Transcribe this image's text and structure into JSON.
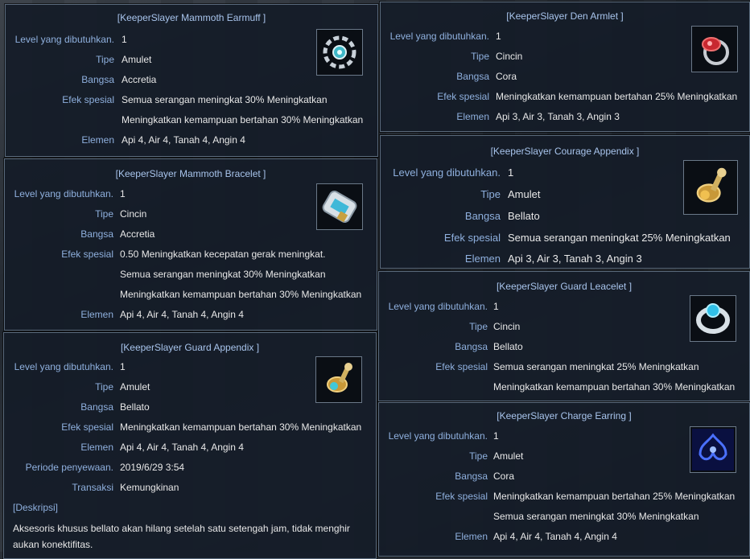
{
  "tooltips": [
    {
      "title": "[KeeperSlayer Mammoth Earmuff ]",
      "icon": "earmuff-icon",
      "rows": [
        {
          "label": "Level yang dibutuhkan.",
          "value": "1"
        },
        {
          "label": "Tipe",
          "value": "Amulet"
        },
        {
          "label": "Bangsa",
          "value": "Accretia"
        },
        {
          "label": "Efek spesial",
          "value": "Semua serangan meningkat 30% Meningkatkan"
        },
        {
          "label": "",
          "value": "Meningkatkan kemampuan bertahan 30% Meningkatkan"
        },
        {
          "label": "Elemen",
          "value": "Api 4, Air 4, Tanah 4, Angin 4"
        }
      ]
    },
    {
      "title": "[KeeperSlayer Mammoth Bracelet ]",
      "icon": "bracelet-icon",
      "rows": [
        {
          "label": "Level yang dibutuhkan.",
          "value": "1"
        },
        {
          "label": "Tipe",
          "value": "Cincin"
        },
        {
          "label": "Bangsa",
          "value": "Accretia"
        },
        {
          "label": "Efek spesial",
          "value": "0.50 Meningkatkan kecepatan gerak meningkat."
        },
        {
          "label": "",
          "value": "Semua serangan meningkat 30% Meningkatkan"
        },
        {
          "label": "",
          "value": "Meningkatkan kemampuan bertahan 30% Meningkatkan"
        },
        {
          "label": "Elemen",
          "value": "Api 4, Air 4, Tanah 4, Angin 4"
        }
      ]
    },
    {
      "title": "[KeeperSlayer Guard Appendix ]",
      "icon": "appendix-icon",
      "rows": [
        {
          "label": "Level yang dibutuhkan.",
          "value": "1"
        },
        {
          "label": "Tipe",
          "value": "Amulet"
        },
        {
          "label": "Bangsa",
          "value": "Bellato"
        },
        {
          "label": "Efek spesial",
          "value": "Meningkatkan kemampuan bertahan 30% Meningkatkan"
        },
        {
          "label": "Elemen",
          "value": "Api 4, Air 4, Tanah 4, Angin 4"
        },
        {
          "label": "Periode penyewaan.",
          "value": "2019/6/29 3:54"
        },
        {
          "label": "Transaksi",
          "value": "Kemungkinan"
        }
      ],
      "desc_label": "[Deskripsi]",
      "desc_text": "Aksesoris khusus bellato akan hilang setelah satu setengah jam, tidak menghir aukan konektifitas."
    },
    {
      "title": "[KeeperSlayer Den Armlet ]",
      "icon": "ring-icon",
      "rows": [
        {
          "label": "Level yang dibutuhkan.",
          "value": "1"
        },
        {
          "label": "Tipe",
          "value": "Cincin"
        },
        {
          "label": "Bangsa",
          "value": "Cora"
        },
        {
          "label": "Efek spesial",
          "value": "Meningkatkan kemampuan bertahan 25% Meningkatkan"
        },
        {
          "label": "Elemen",
          "value": "Api 3, Air 3, Tanah 3, Angin 3"
        }
      ]
    },
    {
      "title": "[KeeperSlayer Courage Appendix ]",
      "icon": "appendix-icon",
      "rows": [
        {
          "label": "Level yang dibutuhkan.",
          "value": "1"
        },
        {
          "label": "Tipe",
          "value": "Amulet"
        },
        {
          "label": "Bangsa",
          "value": "Bellato"
        },
        {
          "label": "Efek spesial",
          "value": "Semua serangan meningkat 25% Meningkatkan"
        },
        {
          "label": "Elemen",
          "value": "Api 3, Air 3, Tanah 3, Angin 3"
        }
      ]
    },
    {
      "title": "[KeeperSlayer Guard Leacelet ]",
      "icon": "leacelet-icon",
      "rows": [
        {
          "label": "Level yang dibutuhkan.",
          "value": "1"
        },
        {
          "label": "Tipe",
          "value": "Cincin"
        },
        {
          "label": "Bangsa",
          "value": "Bellato"
        },
        {
          "label": "Efek spesial",
          "value": "Semua serangan meningkat 25% Meningkatkan"
        },
        {
          "label": "",
          "value": "Meningkatkan kemampuan bertahan 30% Meningkatkan"
        }
      ]
    },
    {
      "title": "[KeeperSlayer Charge Earring ]",
      "icon": "earring-icon",
      "rows": [
        {
          "label": "Level yang dibutuhkan.",
          "value": "1"
        },
        {
          "label": "Tipe",
          "value": "Amulet"
        },
        {
          "label": "Bangsa",
          "value": "Cora"
        },
        {
          "label": "Efek spesial",
          "value": "Meningkatkan kemampuan bertahan 25% Meningkatkan"
        },
        {
          "label": "",
          "value": "Semua serangan meningkat 30% Meningkatkan"
        },
        {
          "label": "Elemen",
          "value": "Api 4, Air 4, Tanah 4, Angin 4"
        }
      ]
    }
  ]
}
